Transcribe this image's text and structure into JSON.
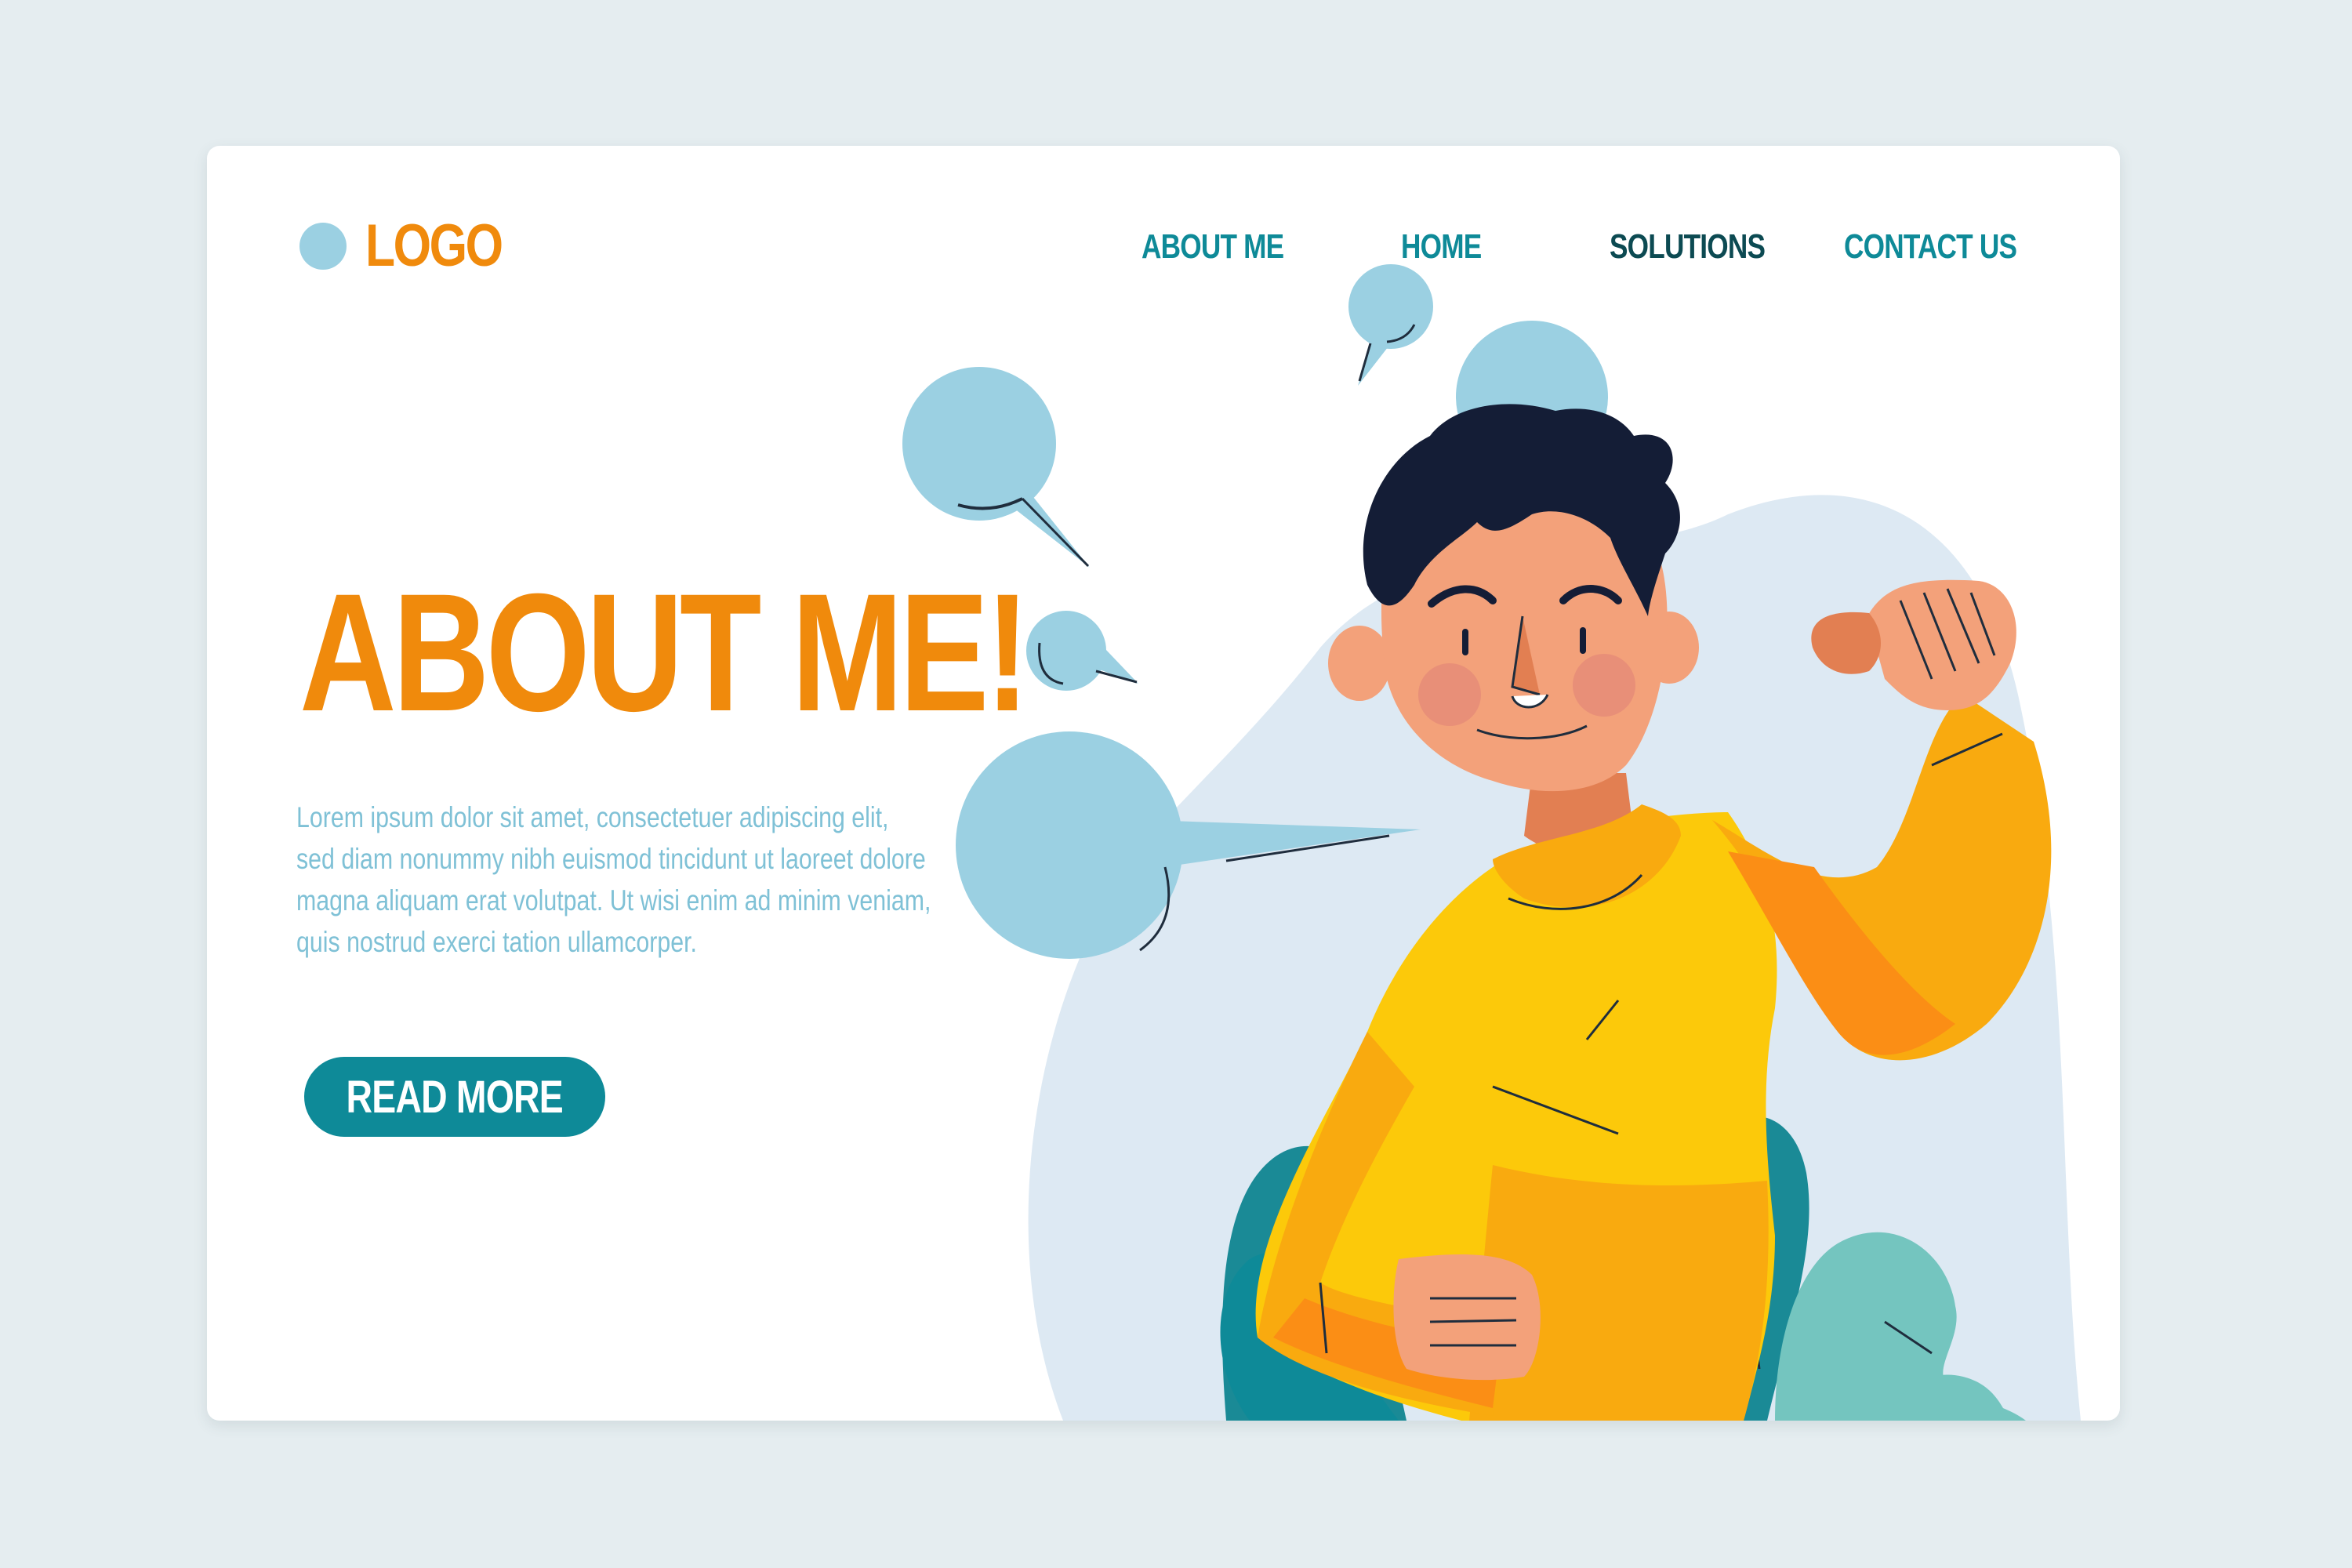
{
  "header": {
    "logo_text": "LOGO",
    "nav": [
      {
        "label": "ABOUT ME"
      },
      {
        "label": "HOME"
      },
      {
        "label": "SOLUTIONS"
      },
      {
        "label": "CONTACT US"
      }
    ]
  },
  "hero": {
    "title": "ABOUT ME!",
    "body": "Lorem ipsum dolor sit amet, consectetuer adipiscing elit, sed diam nonummy nibh euismod tincidunt ut laoreet dolore magna aliquam erat volutpat. Ut wisi enim ad minim veniam, quis nostrud exerci tation ullamcorper.",
    "cta_label": "READ MORE"
  },
  "icons": [
    "logo-dot-icon",
    "speech-bubble-icon",
    "person-illustration",
    "leaf-icon"
  ],
  "colors": {
    "background": "#e5edf0",
    "accent_orange": "#f08a0c",
    "teal": "#0e8a98",
    "dark_teal": "#0c4a52",
    "light_blue": "#9bd0e2",
    "body_text": "#7fc1d6",
    "shirt_yellow": "#fcc90a"
  }
}
